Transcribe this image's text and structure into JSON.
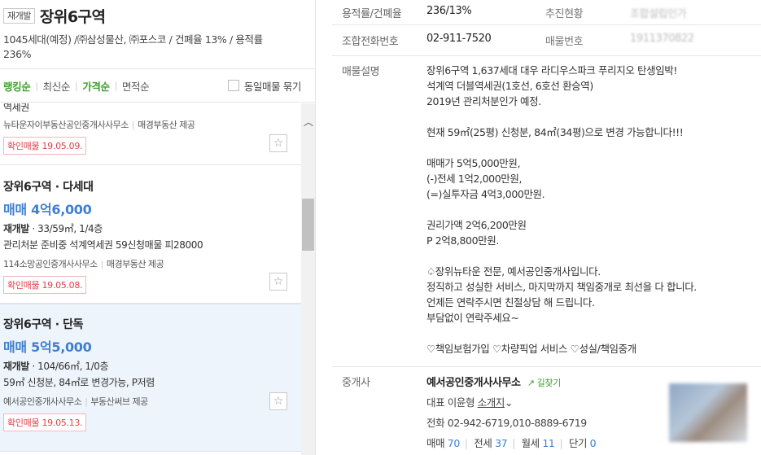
{
  "header": {
    "badge": "재개발",
    "title": "장위6구역",
    "subtitle": "1045세대(예정) /㈜삼성물산, ㈜포스코 / 건폐율 13% / 용적률 236%"
  },
  "sort": {
    "options": [
      "랭킹순",
      "최신순",
      "가격순",
      "면적순"
    ],
    "active": [
      "랭킹순",
      "가격순"
    ],
    "same_listing_label": "동일매물 묶기"
  },
  "listings": [
    {
      "partial_desc": "역세권",
      "agent": "뉴타운자이부동산공인중개사사무소",
      "provider": "매경부동산 제공",
      "confirmed": "확인매물 19.05.09."
    },
    {
      "title": "장위6구역 · 다세대",
      "price": "매매 4억6,000",
      "type": "재개발",
      "spec": " · 33/59㎡, 1/4층",
      "desc": "관리처분 준비중 석계역세권 59신청매물 피28000",
      "agent": "114소망공인중개사사무소",
      "provider": "매경부동산 제공",
      "confirmed": "확인매물 19.05.08."
    },
    {
      "title": "장위6구역 · 단독",
      "price": "매매 5억5,000",
      "type": "재개발",
      "spec": " · 104/66㎡, 1/0층",
      "desc": "59㎡ 신청분, 84㎡로 변경가능, P저렴",
      "agent": "예서공인중개사사무소",
      "provider": "부동산써브 제공",
      "confirmed": "확인매물 19.05.13."
    }
  ],
  "detail": {
    "rows": {
      "ratio_label": "용적률/건폐율",
      "ratio_value": "236/13%",
      "progress_label": "추진현황",
      "progress_value": "조합설립인가",
      "phone_label": "조합전화번호",
      "phone_value": "02-911-7520",
      "listing_no_label": "매물번호",
      "listing_no_value": "1911370822",
      "desc_label": "매물설명",
      "broker_label": "중개사"
    },
    "description": [
      "장위6구역 1,637세대 대우 라디우스파크 푸리지오 탄생임박!",
      "석계역 더블역세권(1호선, 6호선 환승역)",
      "2019년 관리처분인가 예정.",
      "",
      "현재 59㎡(25평) 신청분, 84㎡(34평)으로 변경 가능합니다!!!",
      "",
      "매매가 5억5,000만원,",
      "(-)전세 1억2,000만원,",
      "(=)실투자금 4억3,000만원.",
      "",
      "권리가액 2억6,200만원",
      "P 2억8,800만원.",
      "",
      "♤장위뉴타운 전문, 예서공인중개사입니다.",
      "정직하고 성실한 서비스, 마지막까지 책임중개로 최선을 다 합니다.",
      "언제든 연락주시면 친절상담 해 드립니다.",
      "부담없이 연락주세요~",
      "",
      "♡책임보험가입 ♡차량픽업 서비스 ♡성실/책임중개"
    ],
    "broker": {
      "name": "예서공인중개사사무소",
      "findway": "길찾기",
      "rep": "대표 이윤형",
      "intro": "소개지",
      "phone": "전화 02-942-6719,010-8889-6719",
      "counts": {
        "sale_label": "매매",
        "sale": "70",
        "lease_label": "전세",
        "lease": "37",
        "monthly_label": "월세",
        "monthly": "11",
        "short_label": "단기",
        "short": "0"
      }
    }
  }
}
